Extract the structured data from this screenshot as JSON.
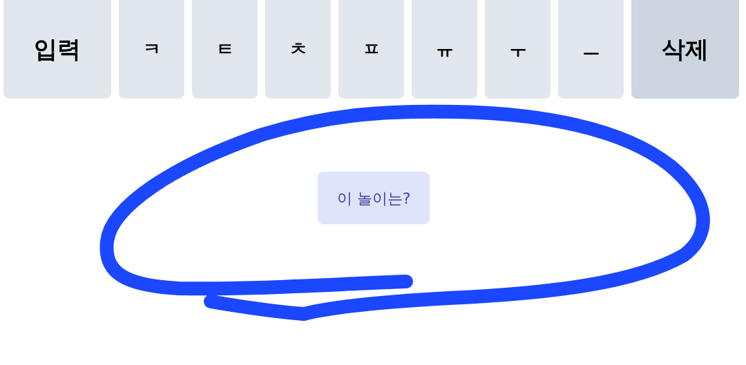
{
  "keys": [
    {
      "label": "입력",
      "kind": "action"
    },
    {
      "label": "ㅋ",
      "kind": "char"
    },
    {
      "label": "ㅌ",
      "kind": "char"
    },
    {
      "label": "ㅊ",
      "kind": "char"
    },
    {
      "label": "ㅍ",
      "kind": "char"
    },
    {
      "label": "ㅠ",
      "kind": "char"
    },
    {
      "label": "ㅜ",
      "kind": "char"
    },
    {
      "label": "ㅡ",
      "kind": "char"
    },
    {
      "label": "삭제",
      "kind": "delete"
    }
  ],
  "prompt_button": {
    "label": "이 놀이는?"
  }
}
